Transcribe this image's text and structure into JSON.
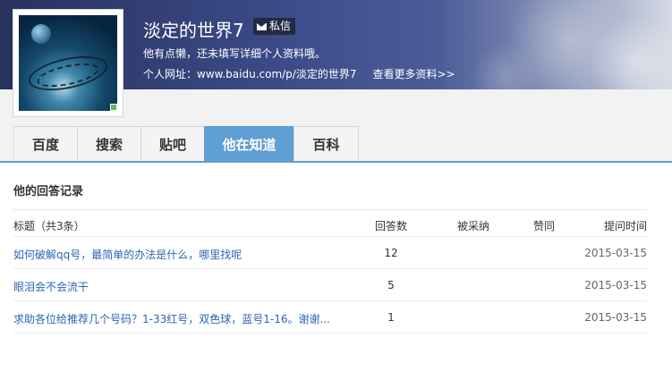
{
  "profile": {
    "username": "淡定的世界7",
    "pm_label": "私信",
    "bio": "他有点懒，还未填写详细个人资料哦。",
    "url_label": "个人网址：",
    "url": "www.baidu.com/p/淡定的世界7",
    "more_link": "查看更多资料>>"
  },
  "tabs": [
    {
      "label": "百度",
      "active": false
    },
    {
      "label": "搜索",
      "active": false
    },
    {
      "label": "贴吧",
      "active": false
    },
    {
      "label": "他在知道",
      "active": true
    },
    {
      "label": "百科",
      "active": false
    }
  ],
  "section": {
    "title": "他的回答记录",
    "headers": {
      "title": "标题（共3条）",
      "answers": "回答数",
      "accepted": "被采纳",
      "likes": "赞同",
      "time": "提问时间"
    },
    "rows": [
      {
        "title": "如何破解qq号，最简单的办法是什么，哪里找呢",
        "answers": "12",
        "accepted": "",
        "likes": "",
        "time": "2015-03-15"
      },
      {
        "title": "眼泪会不会流干",
        "answers": "5",
        "accepted": "",
        "likes": "",
        "time": "2015-03-15"
      },
      {
        "title": "求助各位给推荐几个号码？1-33红号，双色球，蓝号1-16。谢谢...",
        "answers": "1",
        "accepted": "",
        "likes": "",
        "time": "2015-03-15"
      }
    ]
  },
  "colors": {
    "accent": "#5f9fd4",
    "link": "#2d64b3"
  },
  "icons": {
    "pm": "mail-icon",
    "status": "online-status-icon"
  }
}
